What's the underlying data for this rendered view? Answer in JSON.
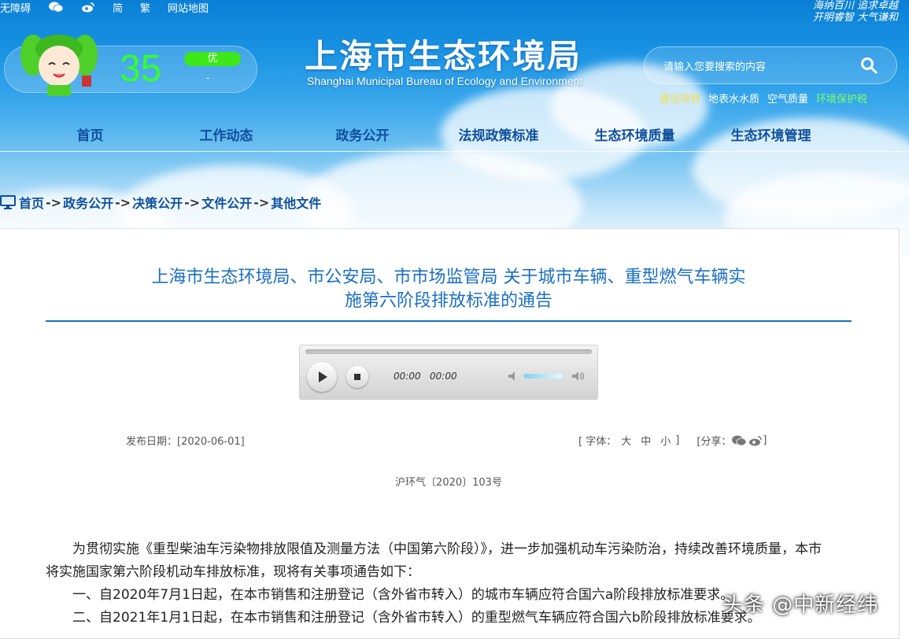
{
  "toplinks": {
    "accessibility": "无障碍",
    "simplified": "简",
    "traditional": "繁",
    "sitemap": "网站地图"
  },
  "slogans": {
    "line1": "海纳百川  追求卓越",
    "line2": "开明睿智  大气谦和"
  },
  "aqi": {
    "value": "35",
    "level": "优",
    "dash": "-"
  },
  "brand": {
    "name_cn": "上海市生态环境局",
    "name_en": "Shanghai Municipal Bureau of Ecology and Environment"
  },
  "search": {
    "placeholder": "请输入您要搜索的内容"
  },
  "quick_links": [
    {
      "label": "建设项目",
      "color": "#f5e04a"
    },
    {
      "label": "地表水水质",
      "color": "#ffffff"
    },
    {
      "label": "空气质量",
      "color": "#ffffff"
    },
    {
      "label": "环境保护税",
      "color": "#7bff6a"
    }
  ],
  "nav": [
    "首页",
    "工作动态",
    "政务公开",
    "法规政策标准",
    "生态环境质量",
    "生态环境管理"
  ],
  "breadcrumb": {
    "items": [
      "首页",
      "政务公开",
      "决策公开",
      "文件公开",
      "其他文件"
    ],
    "sep": "->"
  },
  "article": {
    "title_line1": "上海市生态环境局、市公安局、市市场监管局 关于城市车辆、重型燃气车辆实",
    "title_line2": "施第六阶段排放标准的通告",
    "date_label": "发布日期：[2020-06-01]",
    "font_label": "[ 字体：",
    "font_sizes": [
      "大",
      "中",
      "小"
    ],
    "font_close": "]",
    "share_label": "[分享：",
    "share_close": "]",
    "doc_number": "沪环气〔2020〕103号",
    "paragraphs": [
      "为贯彻实施《重型柴油车污染物排放限值及测量方法（中国第六阶段）》，进一步加强机动车污染防治，持续改善环境质量，本市将实施国家第六阶段机动车排放标准，现将有关事项通告如下：",
      "一、自2020年7月1日起，在本市销售和注册登记（含外省市转入）的城市车辆应符合国六a阶段排放标准要求。",
      "二、自2021年1月1日起，在本市销售和注册登记（含外省市转入）的重型燃气车辆应符合国六b阶段排放标准要求。"
    ]
  },
  "player": {
    "current": "00:00",
    "duration": "00:00",
    "volume": 0.8
  },
  "watermark": "头条 @中新经纬",
  "colors": {
    "nav_text": "#0f4f9c",
    "title": "#1a6fc3",
    "aqi_green": "#33ff33"
  }
}
